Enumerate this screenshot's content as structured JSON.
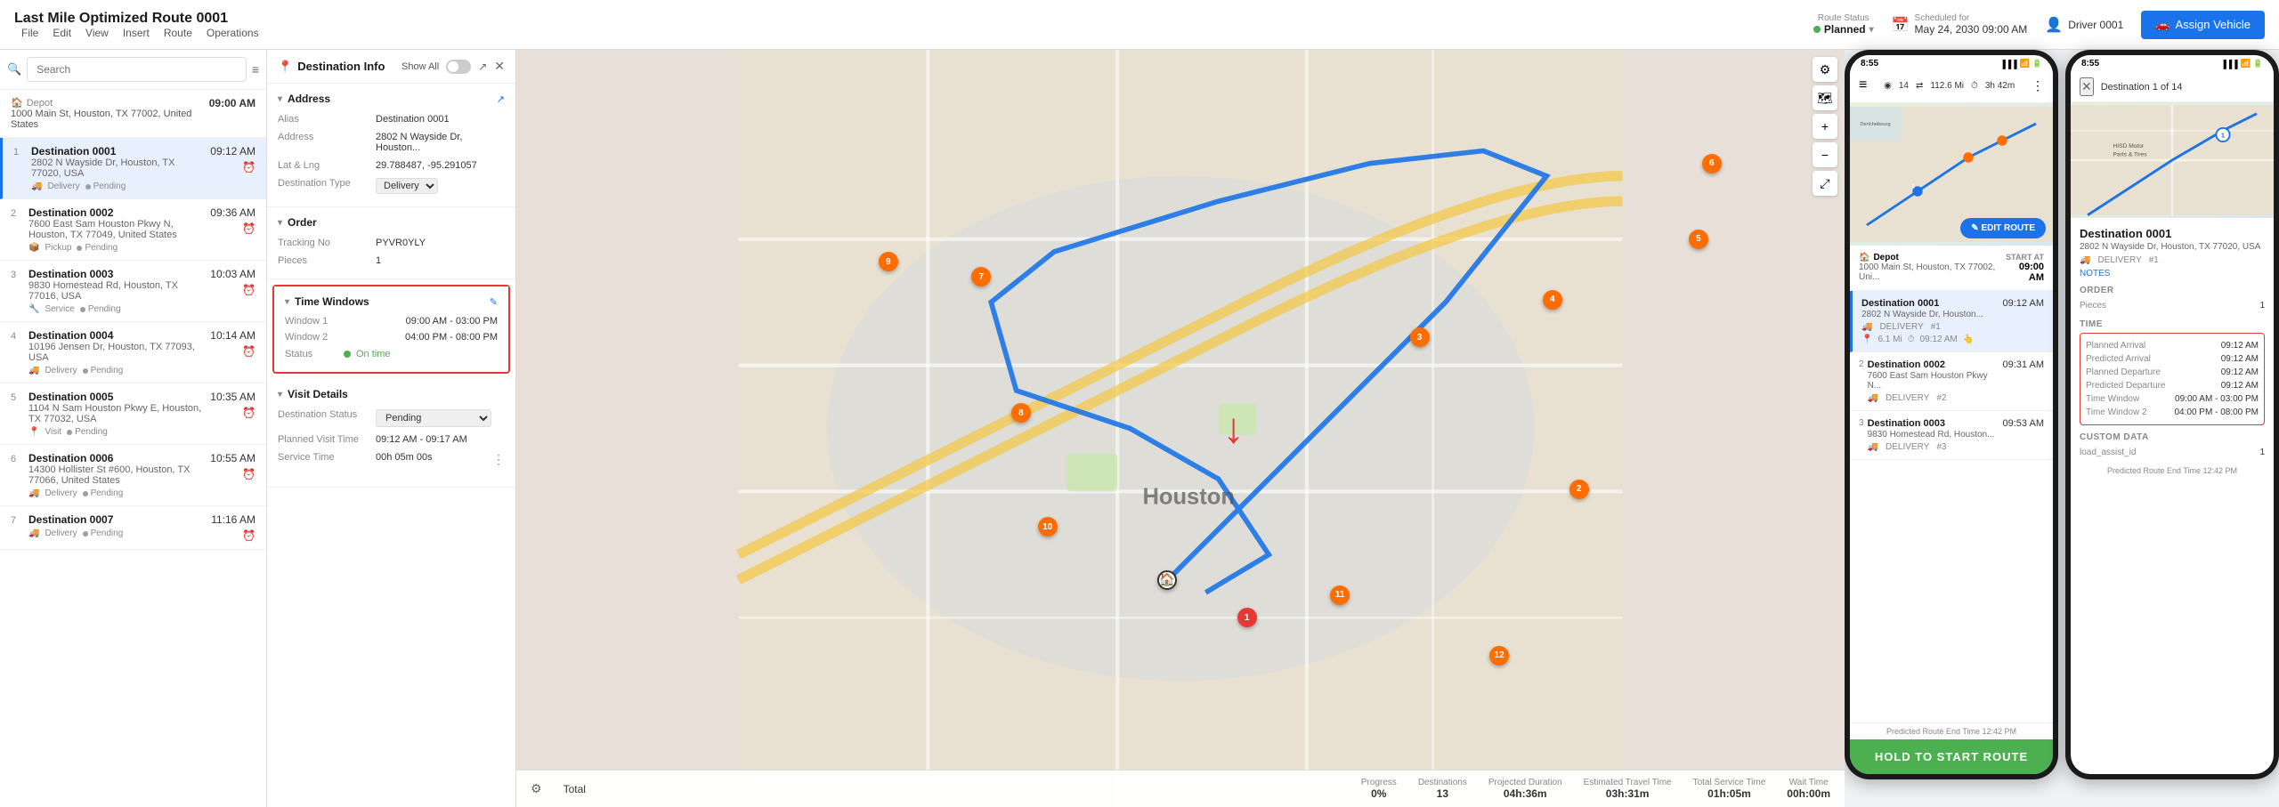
{
  "topbar": {
    "title": "Last Mile Optimized Route 0001",
    "menu": [
      "File",
      "Edit",
      "View",
      "Insert",
      "Route",
      "Operations"
    ],
    "routeStatus": {
      "label": "Route Status",
      "value": "Planned",
      "statusColor": "#4caf50"
    },
    "scheduled": {
      "icon": "calendar-icon",
      "label": "Scheduled for",
      "value": "May 24, 2030 09:00 AM"
    },
    "driver": {
      "icon": "person-icon",
      "label": "Driver 0001"
    },
    "assignVehicle": "Assign Vehicle"
  },
  "leftPanel": {
    "searchPlaceholder": "Search",
    "depot": {
      "label": "Depot",
      "address": "1000 Main St, Houston, TX 77002, United States",
      "time": "09:00 AM"
    },
    "items": [
      {
        "num": "1",
        "name": "Destination 0001",
        "address": "2802 N Wayside Dr, Houston, TX 77020, USA",
        "type": "Delivery",
        "status": "Pending",
        "time": "09:12 AM",
        "active": true
      },
      {
        "num": "2",
        "name": "Destination 0002",
        "address": "7600 East Sam Houston Pkwy N, Houston, TX 77049, United States",
        "type": "Pickup",
        "status": "Pending",
        "time": "09:36 AM",
        "active": false
      },
      {
        "num": "3",
        "name": "Destination 0003",
        "address": "9830 Homestead Rd, Houston, TX 77016, USA",
        "type": "Service",
        "status": "Pending",
        "time": "10:03 AM",
        "active": false
      },
      {
        "num": "4",
        "name": "Destination 0004",
        "address": "10196 Jensen Dr, Houston, TX 77093, USA",
        "type": "Delivery",
        "status": "Pending",
        "time": "10:14 AM",
        "active": false
      },
      {
        "num": "5",
        "name": "Destination 0005",
        "address": "1104 N Sam Houston Pkwy E, Houston, TX 77032, USA",
        "type": "Visit",
        "status": "Pending",
        "time": "10:35 AM",
        "active": false
      },
      {
        "num": "6",
        "name": "Destination 0006",
        "address": "14300 Hollister St #600, Houston, TX 77066, United States",
        "type": "Delivery",
        "status": "Pending",
        "time": "10:55 AM",
        "active": false
      },
      {
        "num": "7",
        "name": "Destination 0007",
        "address": "",
        "type": "Delivery",
        "status": "Pending",
        "time": "11:16 AM",
        "active": false
      }
    ]
  },
  "destInfo": {
    "title": "Destination Info",
    "showAll": "Show All",
    "address": {
      "alias": "Destination 0001",
      "address": "2802 N Wayside Dr, Houston...",
      "latLng": "29.788487, -95.291057",
      "destType": "Delivery"
    },
    "order": {
      "trackingNo": "PYVR0YLY",
      "pieces": "1"
    },
    "timeWindows": {
      "window1": "09:00 AM - 03:00 PM",
      "window2": "04:00 PM - 08:00 PM",
      "status": "On time"
    },
    "visitDetails": {
      "destinationStatus": "Pending",
      "plannedVisitTime": "09:12 AM - 09:17 AM",
      "serviceTime": "00h 05m 00s"
    }
  },
  "mapFooter": {
    "total": "Total",
    "progress": {
      "label": "Progress",
      "value": "0%"
    },
    "destinations": {
      "label": "Destinations",
      "value": "13"
    },
    "projectedDuration": {
      "label": "Projected Duration",
      "value": "04h:36m"
    },
    "estimatedTravelTime": {
      "label": "Estimated Travel Time",
      "value": "03h:31m"
    },
    "totalServiceTime": {
      "label": "Total Service Time",
      "value": "01h:05m"
    },
    "waitTime": {
      "label": "Wait Time",
      "value": "00h:00m"
    }
  },
  "phone1": {
    "time": "8:55",
    "menuIcon": "≡",
    "locationIcon": "◉",
    "distance": "112.6 Mi",
    "duration": "3h 42m",
    "moreIcon": "⋮",
    "depot": {
      "label": "Depot",
      "address": "1000 Main St, Houston, TX 77002, Uni...",
      "startAt": "START AT",
      "time": "09:00 AM"
    },
    "editRouteBtn": "✎ EDIT ROUTE",
    "destinations": [
      {
        "name": "Destination 0001",
        "address": "2802 N Wayside Dr, Houston...",
        "type": "DELIVERY",
        "orderNum": "#1",
        "distance": "6.1 Mi",
        "time": "09:12 AM"
      },
      {
        "name": "Destination 0002",
        "address": "7600 East Sam Houston Pkwy N...",
        "type": "DELIVERY",
        "orderNum": "#2",
        "time": "09:31 AM"
      },
      {
        "name": "Destination 0003",
        "address": "9830 Homestead Rd, Houston...",
        "type": "DELIVERY",
        "orderNum": "#3",
        "time": "09:53 AM"
      }
    ],
    "startBtn": "HOLD TO START ROUTE",
    "predictedTime": "Predicted Route End Time 12:42 PM"
  },
  "phone2": {
    "time": {
      "sectionLabel": "TIME",
      "plannedArrival": {
        "label": "Planned Arrival",
        "value": "09:12 AM"
      },
      "predictedArrival": {
        "label": "Predicted Arrival",
        "value": "09:12 AM"
      },
      "plannedDeparture": {
        "label": "Planned Departure",
        "value": "09:12 AM"
      },
      "predictedDeparture": {
        "label": "Predicted Departure",
        "value": "09:12 AM"
      },
      "timeWindow": {
        "label": "Time Window",
        "value": "09:00 AM - 03:00 PM"
      },
      "timeWindow2": {
        "label": "Time Window 2",
        "value": "04:00 PM - 08:00 PM"
      }
    },
    "closeIcon": "✕",
    "destOf": "Destination 1 of 14",
    "destName": "Destination 0001",
    "destAddr": "2802 N Wayside Dr, Houston, TX 77020, USA",
    "deliveryLabel": "DELIVERY",
    "orderNum": "#1",
    "notesLabel": "NOTES",
    "order": {
      "sectionLabel": "ORDER",
      "piecesLabel": "Pieces",
      "piecesValue": "1"
    },
    "customData": {
      "sectionLabel": "CUSTOM DATA",
      "loadAssistId": {
        "label": "load_assist_id",
        "value": "1"
      }
    },
    "predictedTime": "Predicted Route End Time 12:42 PM"
  }
}
